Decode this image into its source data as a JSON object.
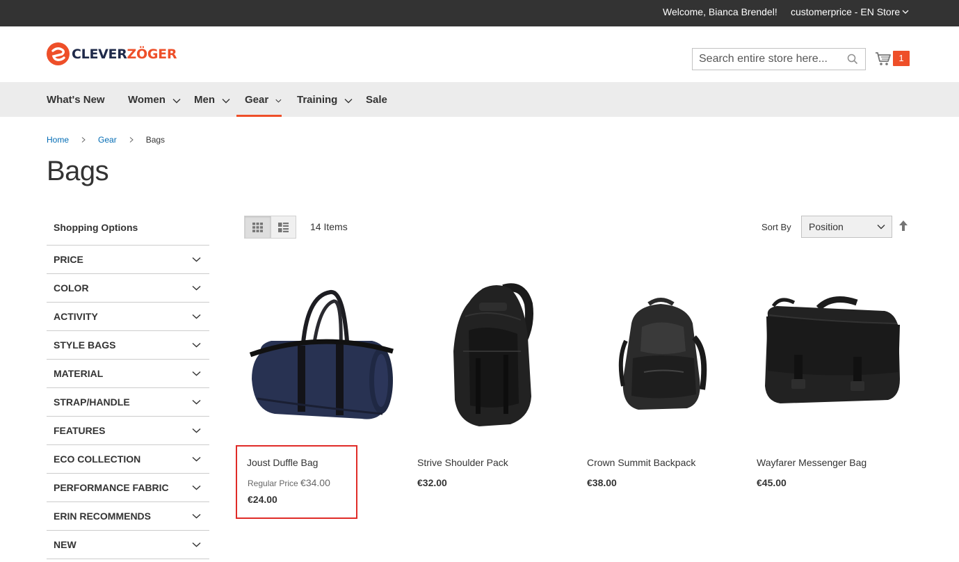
{
  "topbar": {
    "welcome": "Welcome, Bianca Brendel!",
    "store": "customerprice - EN Store"
  },
  "logo": {
    "text_part1": "CLEVER",
    "text_part2": "ZÖGER",
    "brand_color": "#ee4f29",
    "text_color": "#1f2a4a"
  },
  "search": {
    "placeholder": "Search entire store here...",
    "icon": "search-icon"
  },
  "cart": {
    "icon": "cart-icon",
    "count": "1"
  },
  "nav": {
    "items": [
      {
        "label": "What's New",
        "has_dropdown": false
      },
      {
        "label": "Women",
        "has_dropdown": true
      },
      {
        "label": "Men",
        "has_dropdown": true
      },
      {
        "label": "Gear",
        "has_dropdown": true,
        "active": true
      },
      {
        "label": "Training",
        "has_dropdown": true
      },
      {
        "label": "Sale",
        "has_dropdown": false
      }
    ],
    "active_color": "#ee4f29"
  },
  "breadcrumb": {
    "items": [
      "Home",
      "Gear"
    ],
    "current": "Bags"
  },
  "page": {
    "title": "Bags"
  },
  "sidebar": {
    "title": "Shopping Options",
    "filters": [
      "PRICE",
      "COLOR",
      "ACTIVITY",
      "STYLE BAGS",
      "MATERIAL",
      "STRAP/HANDLE",
      "FEATURES",
      "ECO COLLECTION",
      "PERFORMANCE FABRIC",
      "ERIN RECOMMENDS",
      "NEW"
    ]
  },
  "toolbar": {
    "view_modes": [
      "grid",
      "list"
    ],
    "active_mode": "grid",
    "items_count": "14 Items",
    "sort_label": "Sort By",
    "sort_value": "Position",
    "sort_direction_icon": "arrow-up-icon"
  },
  "products": [
    {
      "name": "Joust Duffle Bag",
      "regular_label": "Regular Price",
      "regular_price": "€34.00",
      "special_price": "€24.00",
      "highlighted": true
    },
    {
      "name": "Strive Shoulder Pack",
      "price": "€32.00"
    },
    {
      "name": "Crown Summit Backpack",
      "price": "€38.00"
    },
    {
      "name": "Wayfarer Messenger Bag",
      "price": "€45.00"
    }
  ],
  "colors": {
    "topbar_bg": "#333333",
    "nav_bg": "#ececec",
    "link": "#006bb4",
    "highlight_border": "#e02b27"
  }
}
